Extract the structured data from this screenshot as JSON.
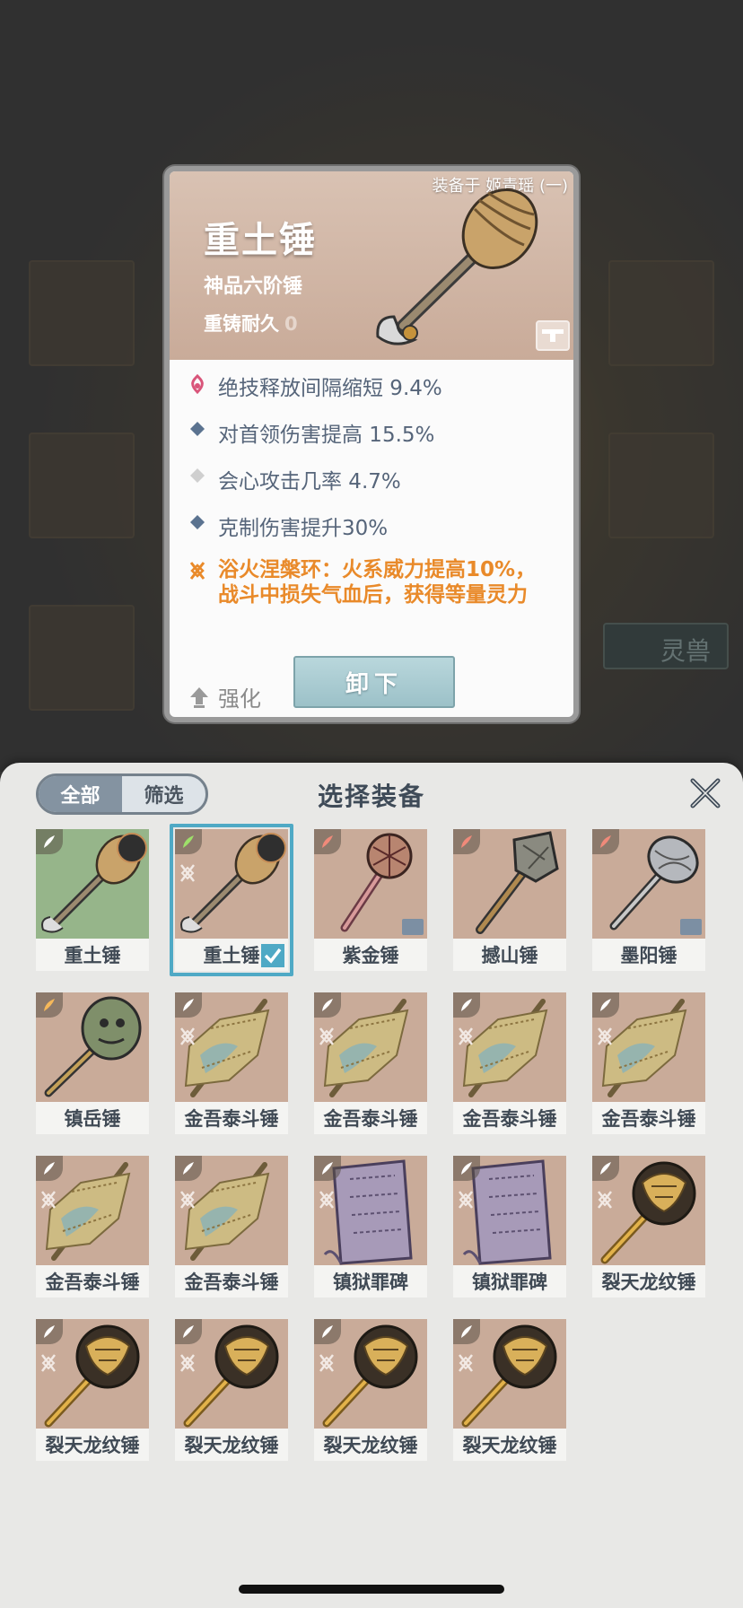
{
  "card": {
    "equipped_label": "装备于 姬青瑶 (一)",
    "name": "重土锤",
    "grade": "神品六阶锤",
    "durability_label": "重铸耐久",
    "durability_value": "0",
    "stats": [
      {
        "icon": "flame-petal-icon",
        "text": "绝技释放间隔缩短 9.4%",
        "style": "normal"
      },
      {
        "icon": "blue-diamond-icon",
        "text": "对首领伤害提高 15.5%",
        "style": "normal"
      },
      {
        "icon": "white-diamond-icon",
        "text": "会心攻击几率 4.7%",
        "style": "normal"
      },
      {
        "icon": "blue-diamond-icon",
        "text": "克制伤害提升30%",
        "style": "normal"
      },
      {
        "icon": "set-bonus-icon",
        "text": "浴火涅槃环：火系威力提高10%，\n战斗中损失气血后，获得等量灵力",
        "style": "orange"
      }
    ],
    "upgrade_label": "强化",
    "unequip_label": "卸下"
  },
  "panel": {
    "filter_all": "全部",
    "filter_screen": "筛选",
    "title": "选择装备"
  },
  "background": {
    "tag": "灵兽"
  },
  "items": [
    {
      "name": "重土锤",
      "bg": "green",
      "grade": "#ffffff",
      "weapon": "gourd",
      "avatar": true
    },
    {
      "name": "重土锤",
      "bg": "tan",
      "grade": "#9ee06a",
      "weapon": "gourd",
      "selected": true,
      "set": true,
      "avatar": true
    },
    {
      "name": "紫金锤",
      "bg": "tan",
      "grade": "#f08a7a",
      "weapon": "purple",
      "lock": true
    },
    {
      "name": "撼山锤",
      "bg": "tan",
      "grade": "#f08a7a",
      "weapon": "stone"
    },
    {
      "name": "墨阳锤",
      "bg": "tan",
      "grade": "#f08a7a",
      "weapon": "silver",
      "lock": true
    },
    {
      "name": "镇岳锤",
      "bg": "tan",
      "grade": "#f5b85a",
      "weapon": "green"
    },
    {
      "name": "金吾泰斗锤",
      "bg": "tan",
      "grade": "#ffffff",
      "weapon": "gold",
      "set": true
    },
    {
      "name": "金吾泰斗锤",
      "bg": "tan",
      "grade": "#ffffff",
      "weapon": "gold",
      "set": true
    },
    {
      "name": "金吾泰斗锤",
      "bg": "tan",
      "grade": "#ffffff",
      "weapon": "gold",
      "set": true
    },
    {
      "name": "金吾泰斗锤",
      "bg": "tan",
      "grade": "#ffffff",
      "weapon": "gold",
      "set": true
    },
    {
      "name": "金吾泰斗锤",
      "bg": "tan",
      "grade": "#ffffff",
      "weapon": "gold",
      "set": true
    },
    {
      "name": "金吾泰斗锤",
      "bg": "tan",
      "grade": "#ffffff",
      "weapon": "gold",
      "set": true
    },
    {
      "name": "镇狱罪碑",
      "bg": "tan",
      "grade": "#ffffff",
      "weapon": "slab",
      "set": true
    },
    {
      "name": "镇狱罪碑",
      "bg": "tan",
      "grade": "#ffffff",
      "weapon": "slab",
      "set": true
    },
    {
      "name": "裂天龙纹锤",
      "bg": "tan",
      "grade": "#ffffff",
      "weapon": "dragon",
      "set": true
    },
    {
      "name": "裂天龙纹锤",
      "bg": "tan",
      "grade": "#ffffff",
      "weapon": "dragon",
      "set": true
    },
    {
      "name": "裂天龙纹锤",
      "bg": "tan",
      "grade": "#ffffff",
      "weapon": "dragon",
      "set": true
    },
    {
      "name": "裂天龙纹锤",
      "bg": "tan",
      "grade": "#ffffff",
      "weapon": "dragon",
      "set": true
    },
    {
      "name": "裂天龙纹锤",
      "bg": "tan",
      "grade": "#ffffff",
      "weapon": "dragon",
      "set": true
    }
  ]
}
